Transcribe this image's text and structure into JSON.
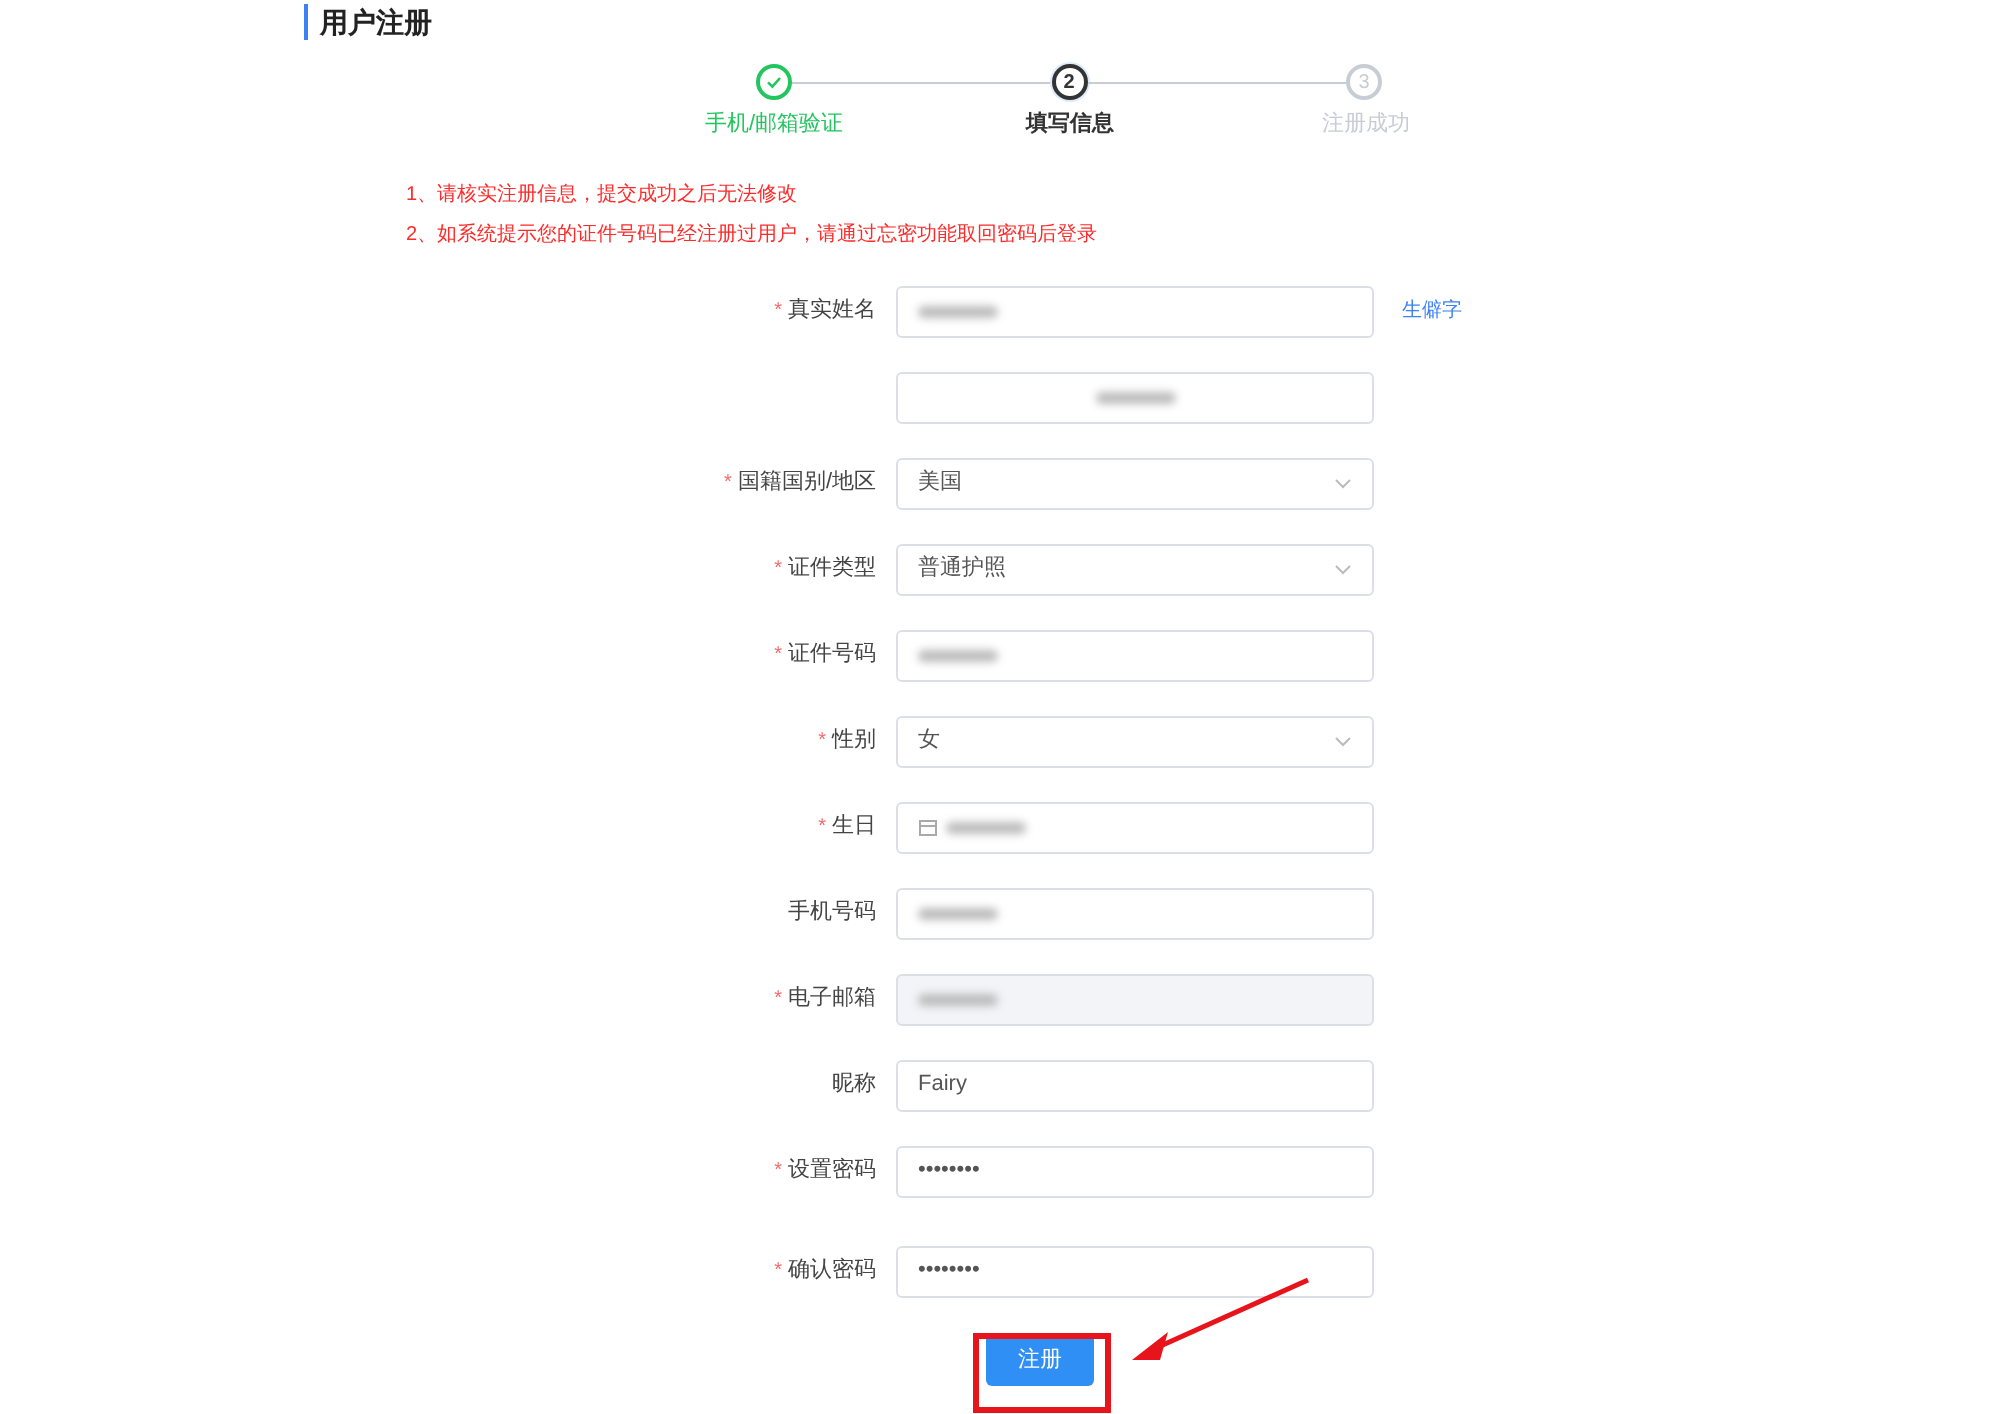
{
  "page_title": "用户注册",
  "steps": [
    {
      "label": "手机/邮箱验证",
      "done": true,
      "current": false
    },
    {
      "icon": "2",
      "label": "填写信息",
      "done": false,
      "current": true
    },
    {
      "icon": "3",
      "label": "注册成功",
      "done": false,
      "current": false
    }
  ],
  "required_marker": "*",
  "notices": [
    "1、请核实注册信息，提交成功之后无法修改",
    "2、如系统提示您的证件号码已经注册过用户，请通过忘密功能取回密码后登录"
  ],
  "fields": [
    {
      "label": "真实姓名",
      "required": true,
      "kind": "text",
      "redacted": true,
      "link": "生僻字"
    },
    {
      "kind": "text",
      "redacted": true,
      "centered": true
    },
    {
      "label": "国籍国别/地区",
      "required": true,
      "kind": "select",
      "value": "美国"
    },
    {
      "label": "证件类型",
      "required": true,
      "kind": "select",
      "value": "普通护照"
    },
    {
      "label": "证件号码",
      "required": true,
      "kind": "text",
      "redacted": true
    },
    {
      "label": "性别",
      "required": true,
      "kind": "select",
      "value": "女"
    },
    {
      "label": "生日",
      "required": true,
      "kind": "date",
      "redacted": true
    },
    {
      "label": "手机号码",
      "required": false,
      "kind": "text",
      "redacted": true
    },
    {
      "label": "电子邮箱",
      "required": true,
      "kind": "disabled",
      "redacted": true
    },
    {
      "label": "昵称",
      "required": false,
      "kind": "text",
      "value": "Fairy"
    },
    {
      "label": "设置密码",
      "required": true,
      "kind": "text",
      "value": "••••••••"
    },
    {
      "label": "确认密码",
      "required": true,
      "kind": "text",
      "value": "••••••••"
    }
  ],
  "submit": "注册",
  "annotation": {
    "highlight": true
  }
}
